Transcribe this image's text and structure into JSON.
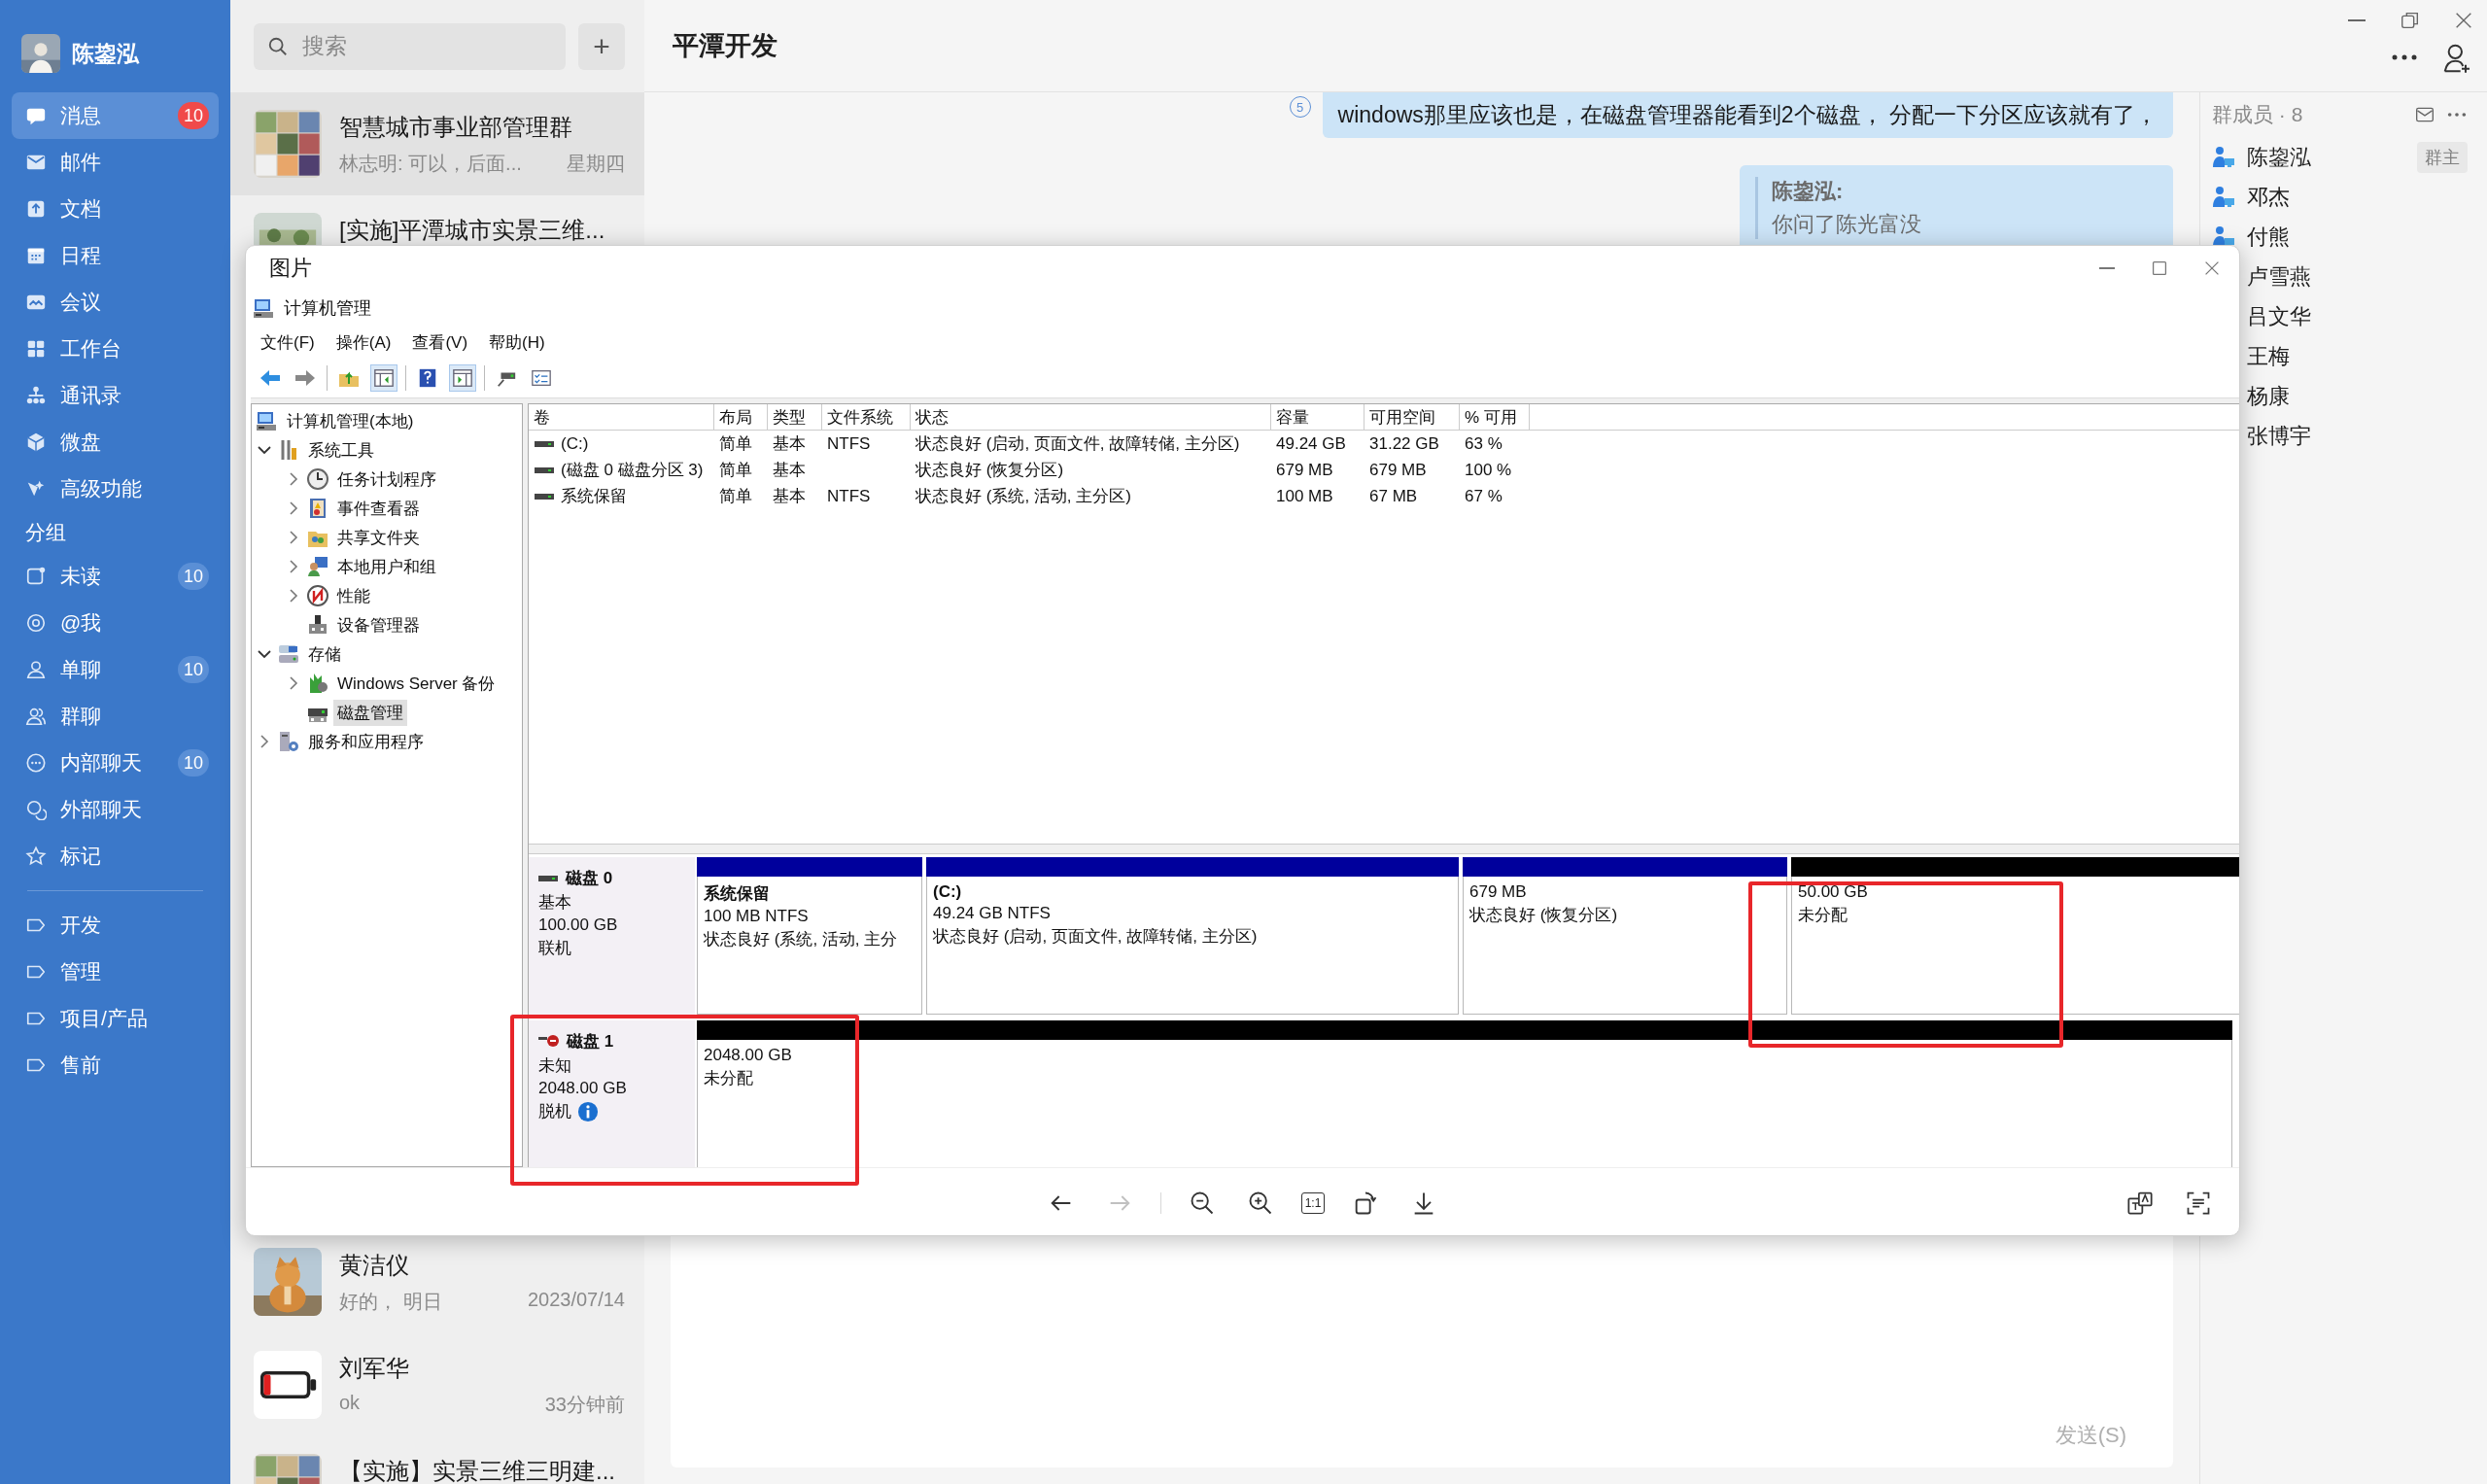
{
  "sidebar": {
    "user": {
      "name": "陈鋆泓"
    },
    "nav": [
      {
        "label": "消息",
        "badge": "10",
        "selected": true
      },
      {
        "label": "邮件",
        "selected": false
      },
      {
        "label": "文档",
        "selected": false
      },
      {
        "label": "日程",
        "selected": false
      },
      {
        "label": "会议",
        "selected": false
      },
      {
        "label": "工作台",
        "selected": false
      },
      {
        "label": "通讯录",
        "selected": false
      },
      {
        "label": "微盘",
        "selected": false
      },
      {
        "label": "高级功能",
        "selected": false
      }
    ],
    "group_heading": "分组",
    "groups": [
      {
        "label": "未读",
        "badge": "10",
        "selected": false
      },
      {
        "label": "@我",
        "selected": false
      },
      {
        "label": "单聊",
        "badge": "10",
        "selected": false
      },
      {
        "label": "群聊",
        "selected": false
      },
      {
        "label": "内部聊天",
        "badge": "10",
        "selected": false
      },
      {
        "label": "外部聊天",
        "selected": false
      },
      {
        "label": "标记",
        "selected": false
      }
    ],
    "tags": [
      {
        "label": "开发",
        "selected": false
      },
      {
        "label": "管理",
        "selected": false
      },
      {
        "label": "项目/产品",
        "selected": false
      },
      {
        "label": "售前",
        "selected": false
      }
    ]
  },
  "chat_list": {
    "search": {
      "placeholder": "搜索"
    },
    "add_button": "+",
    "chats_top": [
      {
        "title": "智慧城市事业部管理群",
        "preview": "林志明: 可以，后面...",
        "time": "星期四",
        "selected": true
      },
      {
        "title": "[实施]平潭城市实景三维...",
        "selected": false
      }
    ],
    "chats_bottom": [
      {
        "title": "黄洁仪",
        "preview": "好的， 明日",
        "time": "2023/07/14",
        "selected": false
      },
      {
        "title": "刘军华",
        "preview": "ok",
        "time": "33分钟前",
        "selected": false
      },
      {
        "title": "【实施】实景三维三明建...",
        "selected": false
      }
    ]
  },
  "chat": {
    "title": "平潭开发",
    "messages": [
      {
        "kind": "text",
        "read_count": "5",
        "text": "windows那里应该也是，在磁盘管理器能看到2个磁盘， 分配一下分区应该就有了，"
      },
      {
        "kind": "quote",
        "author": "陈鋆泓:",
        "text": "你问了陈光富没"
      }
    ],
    "send_button": "发送(S)"
  },
  "members": {
    "title": "群成员 · 8",
    "list": [
      {
        "name": "陈鋆泓",
        "role": "群主"
      },
      {
        "name": "邓杰"
      },
      {
        "name": "付熊"
      },
      {
        "name": "卢雪燕"
      },
      {
        "name": "吕文华"
      },
      {
        "name": "王梅"
      },
      {
        "name": "杨康"
      },
      {
        "name": "张博宇"
      }
    ]
  },
  "viewer": {
    "title": "图片",
    "back_disabled": false,
    "forward_disabled": true,
    "actual_size": "1:1",
    "screenshot": {
      "title": "计算机管理",
      "menu": [
        "文件(F)",
        "操作(A)",
        "查看(V)",
        "帮助(H)"
      ],
      "tree": [
        {
          "label": "计算机管理(本地)",
          "kind": "root",
          "selected": false,
          "children": [
            {
              "label": "系统工具",
              "kind": "branch",
              "expanded": true,
              "selected": false,
              "children": [
                {
                  "label": "任务计划程序",
                  "kind": "branch",
                  "expanded": false,
                  "selected": false
                },
                {
                  "label": "事件查看器",
                  "kind": "branch",
                  "expanded": false,
                  "selected": false
                },
                {
                  "label": "共享文件夹",
                  "kind": "branch",
                  "expanded": false,
                  "selected": false
                },
                {
                  "label": "本地用户和组",
                  "kind": "branch",
                  "expanded": false,
                  "selected": false
                },
                {
                  "label": "性能",
                  "kind": "branch",
                  "expanded": false,
                  "selected": false
                },
                {
                  "label": "设备管理器",
                  "kind": "leaf",
                  "expanded": false,
                  "selected": false
                }
              ]
            },
            {
              "label": "存储",
              "kind": "branch",
              "expanded": true,
              "selected": false,
              "children": [
                {
                  "label": "Windows Server 备份",
                  "kind": "branch",
                  "expanded": false,
                  "selected": false
                },
                {
                  "label": "磁盘管理",
                  "kind": "leaf",
                  "expanded": false,
                  "selected": true
                }
              ]
            },
            {
              "label": "服务和应用程序",
              "kind": "branch",
              "expanded": false,
              "selected": false
            }
          ]
        }
      ],
      "columns": [
        "卷",
        "布局",
        "类型",
        "文件系统",
        "状态",
        "容量",
        "可用空间",
        "% 可用"
      ],
      "volumes": [
        {
          "volume": "(C:)",
          "layout": "简单",
          "type": "基本",
          "file_system": "NTFS",
          "status": "状态良好 (启动, 页面文件, 故障转储, 主分区)",
          "capacity": "49.24 GB",
          "free": "31.22 GB",
          "percent_free": "63 %"
        },
        {
          "volume": "(磁盘 0 磁盘分区 3)",
          "layout": "简单",
          "type": "基本",
          "status": "状态良好 (恢复分区)",
          "capacity": "679 MB",
          "free": "679 MB",
          "percent_free": "100 %"
        },
        {
          "volume": "系统保留",
          "layout": "简单",
          "type": "基本",
          "file_system": "NTFS",
          "status": "状态良好 (系统, 活动, 主分区)",
          "capacity": "100 MB",
          "free": "67 MB",
          "percent_free": "67 %"
        }
      ],
      "disks": [
        {
          "name": "磁盘 0",
          "type": "基本",
          "size": "100.00 GB",
          "status": "联机",
          "offline": false,
          "partitions": [
            {
              "kind": "primary",
              "name": "系统保留",
              "size": "100 MB NTFS",
              "status": "状态良好 (系统, 活动, 主分"
            },
            {
              "kind": "primary",
              "name": "(C:)",
              "size": "49.24 GB NTFS",
              "status": "状态良好 (启动, 页面文件, 故障转储, 主分区)"
            },
            {
              "kind": "primary",
              "size": "679 MB",
              "status": "状态良好 (恢复分区)"
            },
            {
              "kind": "unallocated",
              "size": "50.00 GB",
              "status": "未分配"
            }
          ]
        },
        {
          "name": "磁盘 1",
          "type": "未知",
          "size": "2048.00 GB",
          "status": "脱机",
          "offline": true,
          "partitions": [
            {
              "kind": "unallocated",
              "size": "2048.00 GB",
              "status": "未分配"
            }
          ]
        }
      ]
    }
  }
}
